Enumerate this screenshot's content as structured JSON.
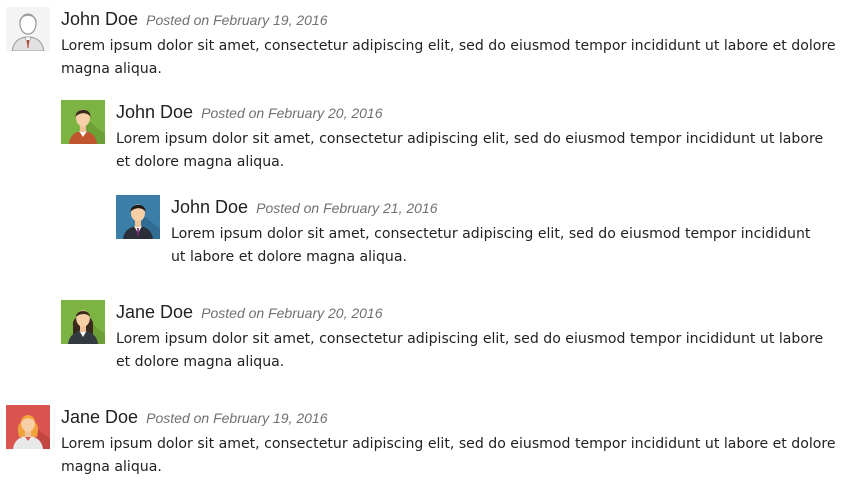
{
  "comments": [
    {
      "author": "John Doe",
      "meta": "Posted on February 19, 2016",
      "text": "Lorem ipsum dolor sit amet, consectetur adipiscing elit, sed do eiusmod tempor incididunt ut labore et dolore magna aliqua.",
      "avatar": "default-person-avatar-icon"
    },
    {
      "author": "John Doe",
      "meta": "Posted on February 20, 2016",
      "text": "Lorem ipsum dolor sit amet, consectetur adipiscing elit, sed do eiusmod tempor incididunt ut labore et dolore magna aliqua.",
      "avatar": "man-green-avatar-icon"
    },
    {
      "author": "John Doe",
      "meta": "Posted on February 21, 2016",
      "text": "Lorem ipsum dolor sit amet, consectetur adipiscing elit, sed do eiusmod tempor incididunt ut labore et dolore magna aliqua.",
      "avatar": "man-suit-blue-avatar-icon"
    },
    {
      "author": "Jane Doe",
      "meta": "Posted on February 20, 2016",
      "text": "Lorem ipsum dolor sit amet, consectetur adipiscing elit, sed do eiusmod tempor incididunt ut labore et dolore magna aliqua.",
      "avatar": "woman-green-avatar-icon"
    },
    {
      "author": "Jane Doe",
      "meta": "Posted on February 19, 2016",
      "text": "Lorem ipsum dolor sit amet, consectetur adipiscing elit, sed do eiusmod tempor incididunt ut labore et dolore magna aliqua.",
      "avatar": "woman-red-avatar-icon"
    }
  ],
  "colors": {
    "avatar_green": "#7cb342",
    "avatar_blue": "#3b7fa8",
    "avatar_red": "#d9534f",
    "meta_text": "#707070"
  }
}
